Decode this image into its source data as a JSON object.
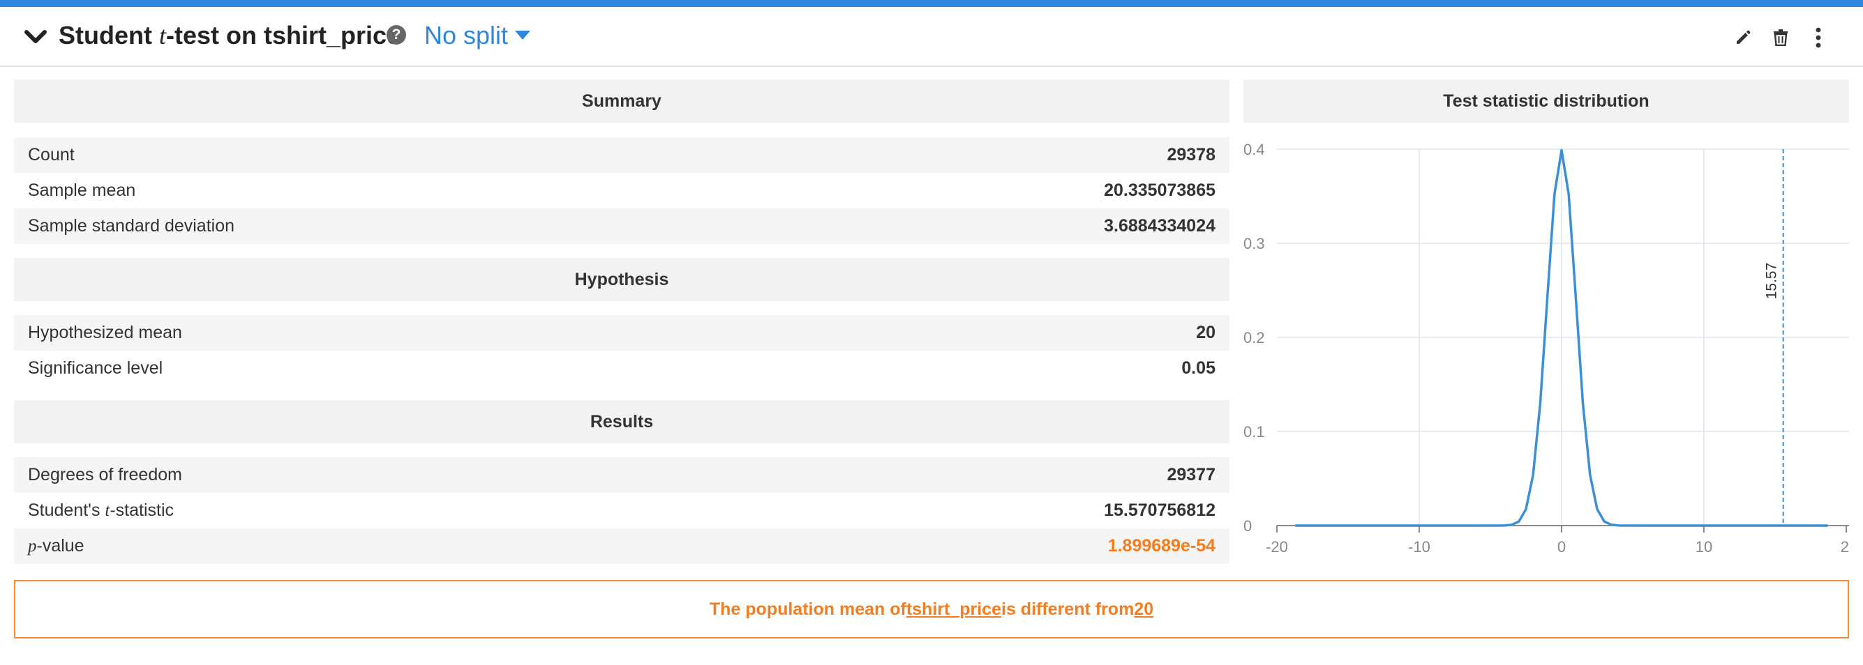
{
  "header": {
    "title_prefix": "Student ",
    "title_t": "t",
    "title_suffix": "-test on tshirt_price",
    "help_label": "?",
    "split_label": "No split",
    "icons": [
      "chevron-down-icon",
      "help-icon",
      "caret-down-icon",
      "pencil-icon",
      "trash-icon",
      "more-vertical-icon"
    ]
  },
  "summary": {
    "heading": "Summary",
    "rows": [
      {
        "label": "Count",
        "value": "29378"
      },
      {
        "label": "Sample mean",
        "value": "20.335073865"
      },
      {
        "label": "Sample standard deviation",
        "value": "3.6884334024"
      }
    ]
  },
  "hypothesis": {
    "heading": "Hypothesis",
    "rows": [
      {
        "label": "Hypothesized mean",
        "value": "20"
      },
      {
        "label": "Significance level",
        "value": "0.05"
      }
    ]
  },
  "results": {
    "heading": "Results",
    "dof_label": "Degrees of freedom",
    "dof_value": "29377",
    "tstat_label_prefix": "Student's ",
    "tstat_label_t": "t",
    "tstat_label_suffix": "-statistic",
    "tstat_value": "15.570756812",
    "pvalue_label_p": "p",
    "pvalue_label_suffix": "-value",
    "pvalue_value": "1.899689e-54"
  },
  "conclusion": {
    "prefix": "The population mean of ",
    "variable": "tshirt_price",
    "middle": " is different from ",
    "value": "20"
  },
  "chart_title": "Test statistic distribution",
  "colors": {
    "accent": "#2e86de",
    "curve": "#3a8fd6",
    "highlight": "#f57c1f",
    "grid": "#dde3ee"
  },
  "chart_data": {
    "type": "line",
    "title": "Test statistic distribution",
    "xlabel": "",
    "ylabel": "",
    "xlim": [
      -20,
      20
    ],
    "ylim": [
      0,
      0.4
    ],
    "x_ticks": [
      "-20",
      "-10",
      "0",
      "10",
      "2"
    ],
    "y_ticks": [
      "0",
      "0.1",
      "0.2",
      "0.3",
      "0.4"
    ],
    "grid": true,
    "series": [
      {
        "x": [
          -18.7,
          -10,
          -6,
          -4,
          -3.5,
          -3,
          -2.5,
          -2,
          -1.5,
          -1,
          -0.5,
          0,
          0.5,
          1,
          1.5,
          2,
          2.5,
          3,
          3.5,
          4,
          6,
          10,
          18.7
        ],
        "y": [
          0,
          0,
          0,
          0.0001,
          0.0009,
          0.0044,
          0.0175,
          0.054,
          0.1295,
          0.242,
          0.3521,
          0.3989,
          0.3521,
          0.242,
          0.1295,
          0.054,
          0.0175,
          0.0044,
          0.0009,
          0.0001,
          0,
          0,
          0
        ]
      }
    ],
    "annotations": [
      {
        "type": "vline",
        "x": 15.57,
        "label": "15.57",
        "style": "dashed"
      }
    ]
  }
}
